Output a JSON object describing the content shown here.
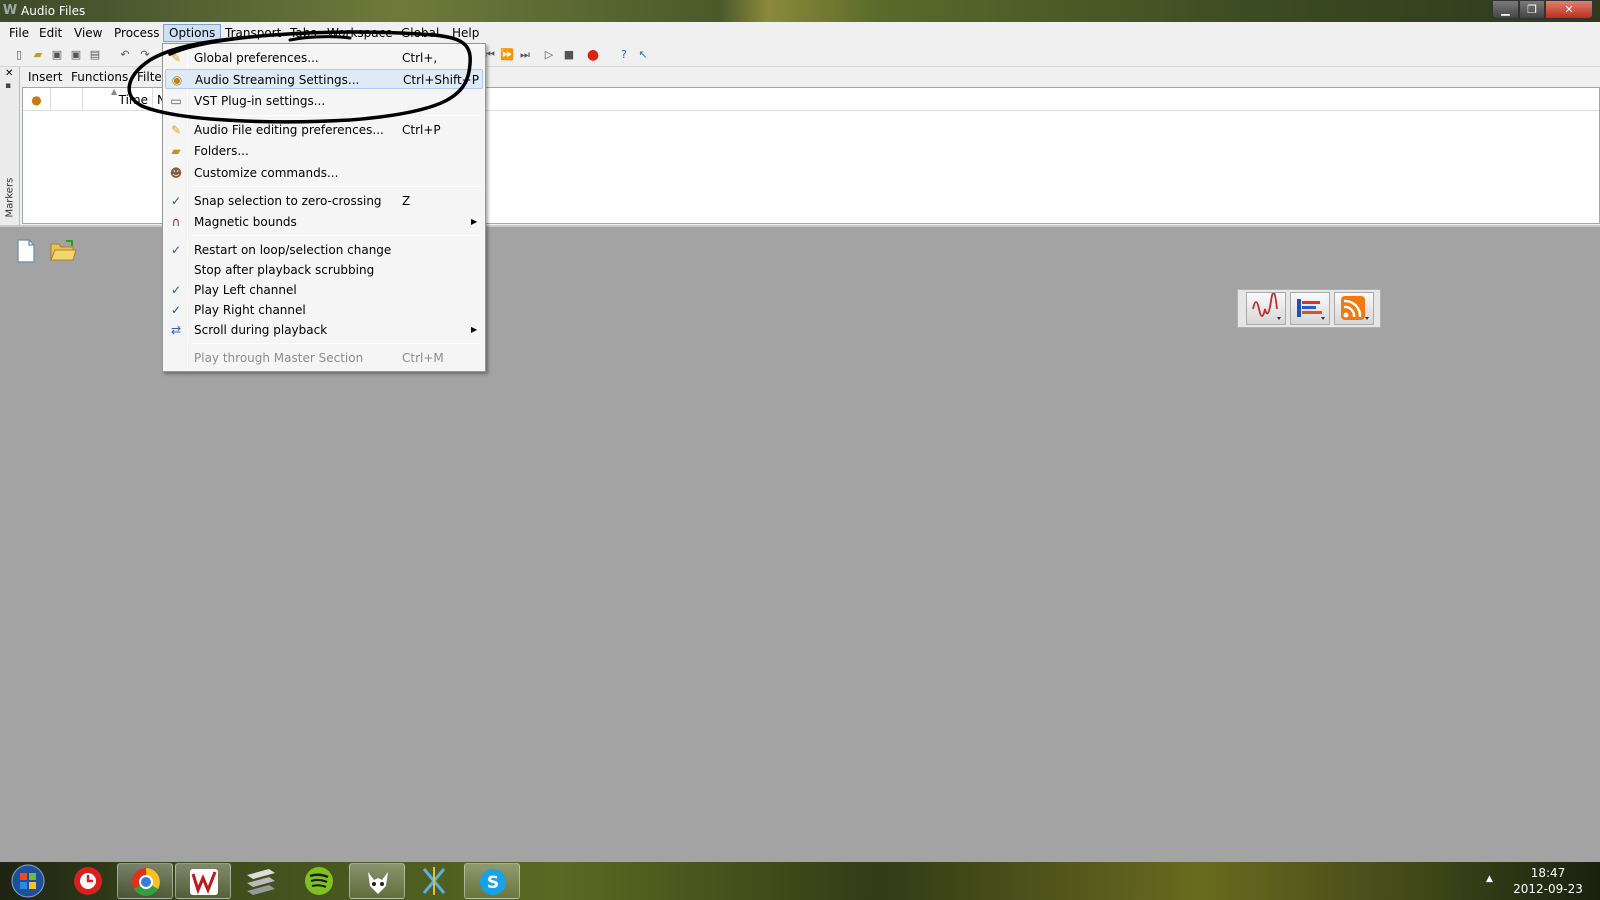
{
  "window": {
    "title": "Audio Files"
  },
  "menubar": {
    "items": [
      "File",
      "Edit",
      "View",
      "Process",
      "Options",
      "Transport",
      "Tabs",
      "Workspace",
      "Global",
      "Help"
    ]
  },
  "panel": {
    "tabs": [
      "Insert",
      "Functions",
      "Filte"
    ],
    "side_label": "Markers",
    "columns": [
      "Time",
      "N"
    ]
  },
  "options_menu": {
    "items": [
      {
        "label": "Global preferences...",
        "shortcut": "Ctrl+,"
      },
      {
        "label": "Audio Streaming Settings...",
        "shortcut": "Ctrl+Shift+P"
      },
      {
        "label": "VST Plug-in settings...",
        "shortcut": ""
      },
      {
        "label": "Audio File editing preferences...",
        "shortcut": "Ctrl+P"
      },
      {
        "label": "Folders...",
        "shortcut": ""
      },
      {
        "label": "Customize commands...",
        "shortcut": ""
      },
      {
        "label": "Snap selection to zero-crossing",
        "shortcut": "Z",
        "checked": true
      },
      {
        "label": "Magnetic bounds",
        "shortcut": "",
        "submenu": true
      },
      {
        "label": "Restart on loop/selection change",
        "shortcut": "",
        "checked": true
      },
      {
        "label": "Stop after playback scrubbing",
        "shortcut": "",
        "checked": false
      },
      {
        "label": "Play Left channel",
        "shortcut": "",
        "checked": true
      },
      {
        "label": "Play Right channel",
        "shortcut": "",
        "checked": true
      },
      {
        "label": "Scroll during playback",
        "shortcut": "",
        "submenu": true
      },
      {
        "label": "Play through Master Section",
        "shortcut": "Ctrl+M",
        "disabled": true
      }
    ]
  },
  "taskbar": {
    "apps": [
      "start-orb",
      "red-app",
      "chrome",
      "wavelab",
      "steam",
      "spotify",
      "foobar",
      "x-app",
      "skype"
    ],
    "time": "18:47",
    "date": "2012-09-23"
  },
  "colors": {
    "menu_highlight": "#cfe0f5",
    "workspace_bg": "#a3a3a3",
    "annotation_ink": "#000000"
  }
}
